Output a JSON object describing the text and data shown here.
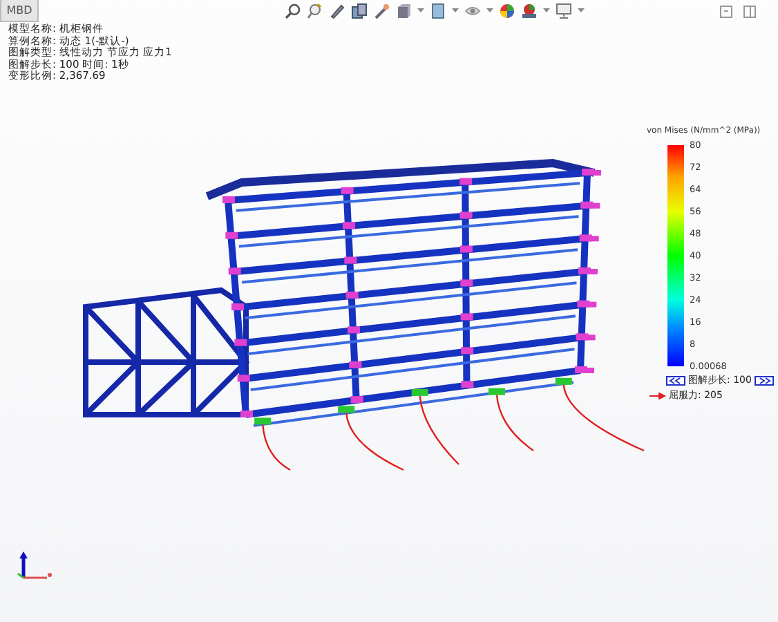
{
  "tab": {
    "label": "MBD"
  },
  "info_lines": [
    "模型名称: 机柜钢件",
    "算例名称: 动态 1(-默认-)",
    "图解类型: 线性动力 节应力 应力1",
    "图解步长: 100  时间: 1秒",
    "变形比例: 2,367.69"
  ],
  "legend": {
    "title": "von Mises (N/mm^2 (MPa))",
    "ticks": [
      "80",
      "72",
      "64",
      "56",
      "48",
      "40",
      "32",
      "24",
      "16",
      "8",
      "0.00068"
    ]
  },
  "step_control": {
    "label": "图解步长: 100"
  },
  "yield_marker": {
    "label": "屈服力: 205"
  }
}
